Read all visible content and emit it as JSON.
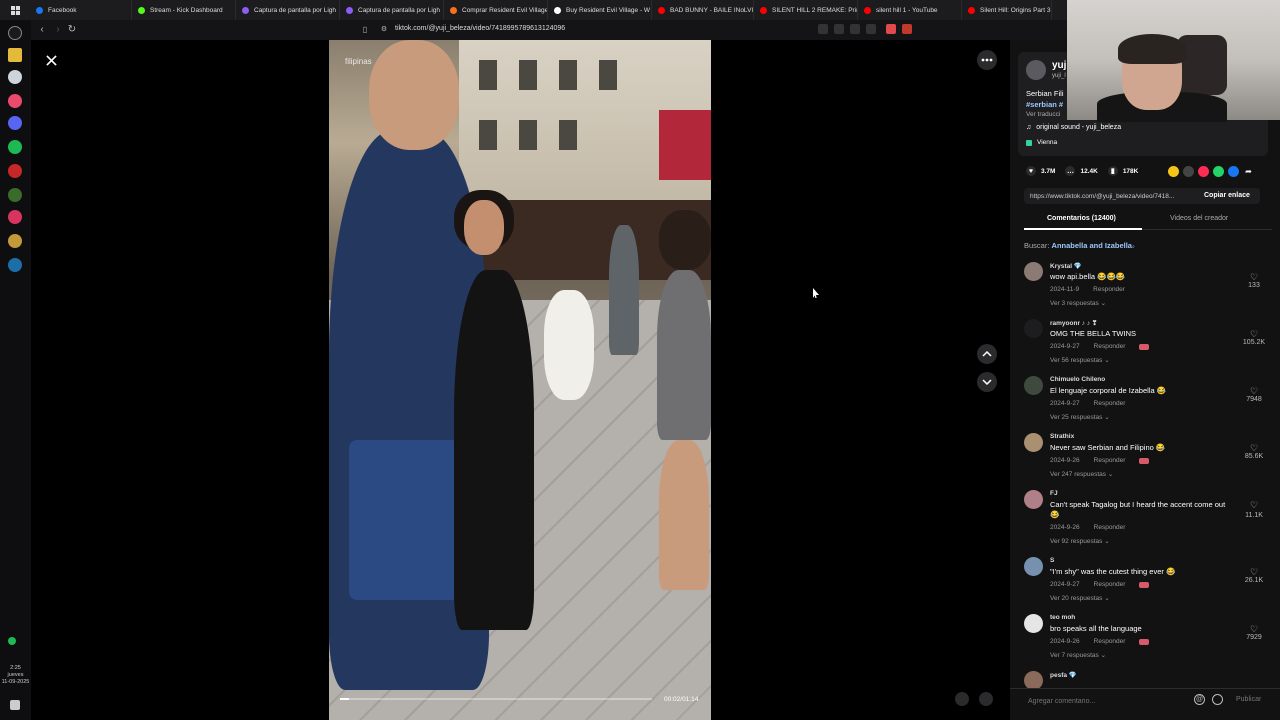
{
  "browser_tabs": [
    {
      "label": "Facebook",
      "color": "#1877f2"
    },
    {
      "label": "Stream - Kick Dashboard",
      "color": "#53fc18"
    },
    {
      "label": "Captura de pantalla por Ligh",
      "color": "#8b5cf6"
    },
    {
      "label": "Captura de pantalla por Ligh",
      "color": "#8b5cf6"
    },
    {
      "label": "Comprar Resident Evil Village",
      "color": "#f97316"
    },
    {
      "label": "Buy Resident Evil Village - W",
      "color": "#ffffff"
    },
    {
      "label": "BAD BUNNY - BAILE INoLVID",
      "color": "#ff0000"
    },
    {
      "label": "SILENT HILL 2 REMAKE: Prime",
      "color": "#ff0000"
    },
    {
      "label": "silent hill 1 - YouTube",
      "color": "#ff0000"
    },
    {
      "label": "Silent Hill: Origins Part 3 | Bo",
      "color": "#ff0000"
    }
  ],
  "address_bar": {
    "url": "tiktok.com/@yuji_beleza/video/7418995789613124096"
  },
  "os_clock": {
    "time": "2:25",
    "day": "jueves",
    "date": "11-09-2025"
  },
  "video": {
    "caption": "filipinas",
    "time": "00:02/01:14",
    "progress": 0.03
  },
  "author": {
    "name": "yuji",
    "sub": "yuji_l",
    "description": "Serbian Fili",
    "hashtag": "#serbian #",
    "see_translation": "Ver traducci",
    "sound": "original sound - yuji_beleza",
    "location": "Vienna"
  },
  "stats": {
    "likes": "3.7M",
    "comments": "12.4K",
    "saves": "178K"
  },
  "link": {
    "url": "https://www.tiktok.com/@yuji_beleza/video/7418...",
    "copy_label": "Copiar enlace"
  },
  "tabs": {
    "comments": "Comentarios (12400)",
    "creator_videos": "Videos del creador"
  },
  "search": {
    "prefix": "Buscar:",
    "query": "Annabella and Izabella"
  },
  "comments": [
    {
      "user": "Krystal 💎",
      "text": "wow api.bella 😂😂😂",
      "date": "2024-11-9",
      "reply": "Responder",
      "replies": "Ver 3 respuestas ⌄",
      "likes": "133",
      "creator_liked": false,
      "avatar": "#8b7b74"
    },
    {
      "user": "ramyoonr ♪ ♪ ❣",
      "text": "OMG THE BELLA TWINS",
      "date": "2024-9-27",
      "reply": "Responder",
      "replies": "Ver 56 respuestas ⌄",
      "likes": "105.2K",
      "creator_liked": true,
      "avatar": "#1d1d1f"
    },
    {
      "user": "Chimuelo Chileno",
      "text": "El lenguaje corporal de Izabella 😂",
      "date": "2024-9-27",
      "reply": "Responder",
      "replies": "Ver 25 respuestas ⌄",
      "likes": "7948",
      "creator_liked": false,
      "avatar": "#3f4a3f"
    },
    {
      "user": "Strathix",
      "text": "Never saw Serbian and Filipino 😂",
      "date": "2024-9-26",
      "reply": "Responder",
      "replies": "Ver 247 respuestas ⌄",
      "likes": "85.6K",
      "creator_liked": true,
      "avatar": "#a89070"
    },
    {
      "user": "FJ",
      "text": "Can't speak Tagalog but I heard the accent come out 😂",
      "date": "2024-9-26",
      "reply": "Responder",
      "replies": "Ver 92 respuestas ⌄",
      "likes": "11.1K",
      "creator_liked": false,
      "avatar": "#b08088"
    },
    {
      "user": "S",
      "text": "\"I'm shy\" was the cutest thing ever 😂",
      "date": "2024-9-27",
      "reply": "Responder",
      "replies": "Ver 20 respuestas ⌄",
      "likes": "26.1K",
      "creator_liked": true,
      "avatar": "#7890b0"
    },
    {
      "user": "teo moh",
      "text": "bro speaks all the language",
      "date": "2024-9-26",
      "reply": "Responder",
      "replies": "Ver 7 respuestas ⌄",
      "likes": "7929",
      "creator_liked": true,
      "avatar": "#e5e5e5"
    },
    {
      "user": "pesfa 💎",
      "text": "",
      "date": "",
      "reply": "",
      "replies": "",
      "likes": "",
      "creator_liked": false,
      "avatar": "#8a6a5a"
    }
  ],
  "comment_bar": {
    "placeholder": "Agregar comentario...",
    "post": "Publicar"
  }
}
